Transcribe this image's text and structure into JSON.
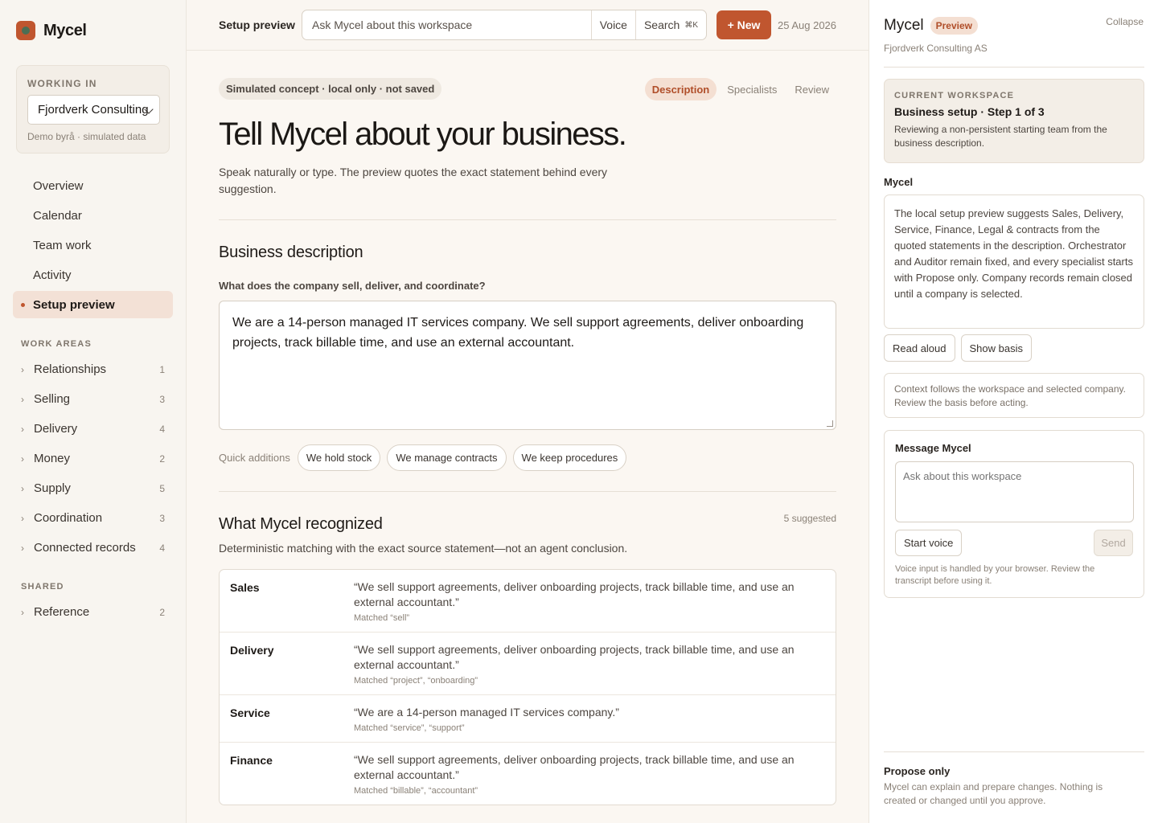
{
  "app": {
    "name": "Mycel"
  },
  "sidebar": {
    "working_label": "WORKING IN",
    "company": "Fjordverk Consulting",
    "demo_note": "Demo byrå · simulated data",
    "nav": [
      "Overview",
      "Calendar",
      "Team work",
      "Activity",
      "Setup preview"
    ],
    "active_nav": "Setup preview",
    "work_areas_label": "WORK AREAS",
    "work_areas": [
      {
        "label": "Relationships",
        "count": "1"
      },
      {
        "label": "Selling",
        "count": "3"
      },
      {
        "label": "Delivery",
        "count": "4"
      },
      {
        "label": "Money",
        "count": "2"
      },
      {
        "label": "Supply",
        "count": "5"
      },
      {
        "label": "Coordination",
        "count": "3"
      },
      {
        "label": "Connected records",
        "count": "4"
      }
    ],
    "shared_label": "SHARED",
    "shared": [
      {
        "label": "Reference",
        "count": "2"
      }
    ]
  },
  "topbar": {
    "title": "Setup preview",
    "search_value": "Ask Mycel about this workspace",
    "voice_label": "Voice",
    "search_label": "Search",
    "search_shortcut": "⌘K",
    "new_label": "+ New",
    "date": "25 Aug 2026"
  },
  "main": {
    "pill": "Simulated concept · local only · not saved",
    "tabs": [
      "Description",
      "Specialists",
      "Review"
    ],
    "active_tab": "Description",
    "heading": "Tell Mycel about your business.",
    "lead": "Speak naturally or type. The preview quotes the exact statement behind every suggestion.",
    "section1_title": "Business description",
    "question": "What does the company sell, deliver, and coordinate?",
    "description": "We are a 14-person managed IT services company. We sell support agreements, deliver onboarding projects, track billable time, and use an external accountant.",
    "quick_label": "Quick additions",
    "quick_chips": [
      "We hold stock",
      "We manage contracts",
      "We keep procedures"
    ],
    "section2_title": "What Mycel recognized",
    "suggested": "5 suggested",
    "section2_sub": "Deterministic matching with the exact source statement—not an agent conclusion.",
    "rows": [
      {
        "name": "Sales",
        "quote": "“We sell support agreements, deliver onboarding projects, track billable time, and use an external accountant.”",
        "match": "Matched “sell”"
      },
      {
        "name": "Delivery",
        "quote": "“We sell support agreements, deliver onboarding projects, track billable time, and use an external accountant.”",
        "match": "Matched “project”, “onboarding”"
      },
      {
        "name": "Service",
        "quote": "“We are a 14-person managed IT services company.”",
        "match": "Matched “service”, “support”"
      },
      {
        "name": "Finance",
        "quote": "“We sell support agreements, deliver onboarding projects, track billable time, and use an external accountant.”",
        "match": "Matched “billable”, “accountant”"
      }
    ]
  },
  "panel": {
    "title": "Mycel",
    "badge": "Preview",
    "collapse": "Collapse",
    "company": "Fjordverk Consulting AS",
    "ws_label": "CURRENT WORKSPACE",
    "ws_title": "Business setup · Step 1 of 3",
    "ws_text": "Reviewing a non-persistent starting team from the business description.",
    "mycel_label": "Mycel",
    "message": "The local setup preview suggests Sales, Delivery, Service, Finance, Legal & contracts from the quoted statements in the description. Orchestrator and Auditor remain fixed, and every specialist starts with Propose only. Company records remain closed until a company is selected.",
    "read_aloud": "Read aloud",
    "show_basis": "Show basis",
    "context_note": "Context follows the workspace and selected company. Review the basis before acting.",
    "compose_label": "Message Mycel",
    "compose_placeholder": "Ask about this workspace",
    "start_voice": "Start voice",
    "send": "Send",
    "voice_note": "Voice input is handled by your browser. Review the transcript before using it.",
    "propose_title": "Propose only",
    "propose_text": "Mycel can explain and prepare changes. Nothing is created or changed until you approve."
  },
  "colors": {
    "accent": "#c0562f",
    "accent_soft": "#f4dfd2",
    "background": "#fbf7f2"
  }
}
